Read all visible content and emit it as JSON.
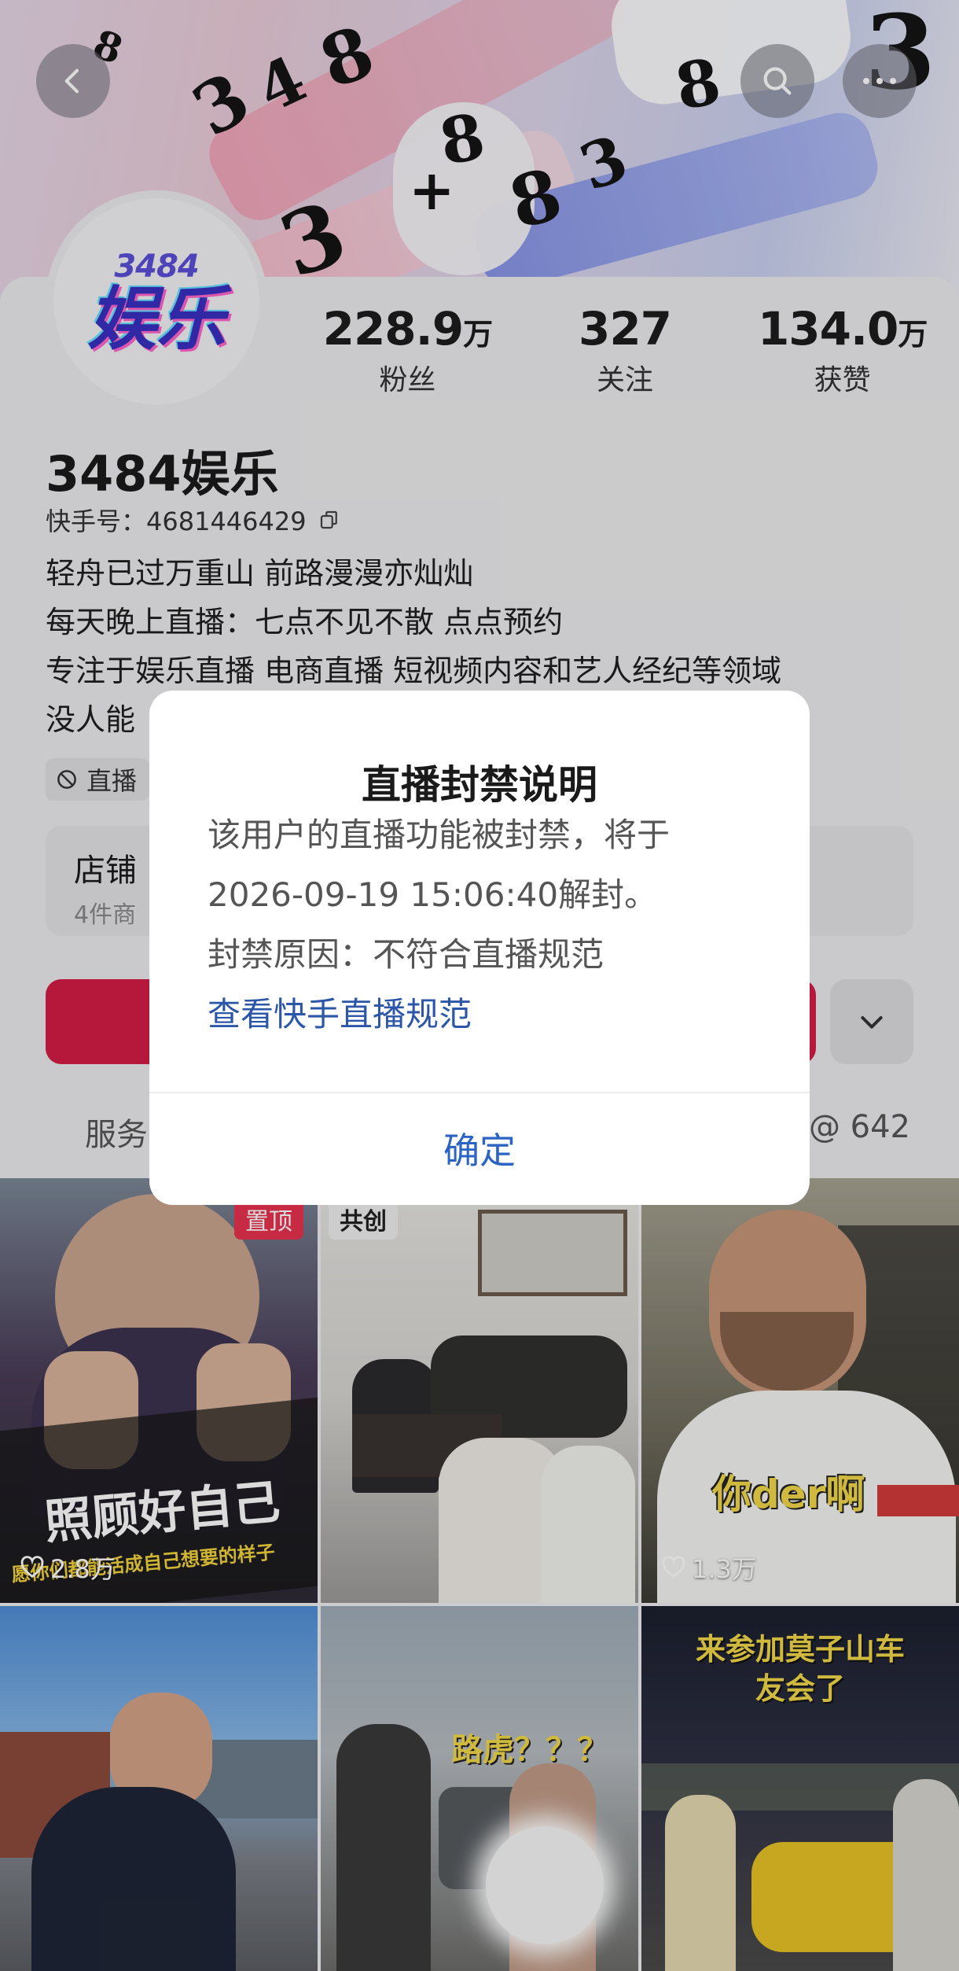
{
  "header": {
    "back_icon": "chevron-left-icon",
    "search_icon": "search-icon",
    "more_icon": "more-dots-icon"
  },
  "profile": {
    "avatar_text_top": "3484",
    "avatar_text_main": "娱乐",
    "name": "3484娱乐",
    "kuaishou_id": "快手号：4681446429",
    "bio": [
      "轻舟已过万重山 前路漫漫亦灿灿",
      "每天晚上直播：七点不见不散 点点预约",
      "专注于娱乐直播 电商直播 短视频内容和艺人经纪等领域",
      "没人能"
    ],
    "tag": "直播",
    "stats": [
      {
        "value": "228.9",
        "unit": "万",
        "label": "粉丝"
      },
      {
        "value": "327",
        "unit": "",
        "label": "关注"
      },
      {
        "value": "134.0",
        "unit": "万",
        "label": "获赞"
      }
    ]
  },
  "shop": {
    "title": "店铺",
    "subtitle": "4件商"
  },
  "tabs": {
    "service": "服务",
    "mentions": "@ 642"
  },
  "videos": [
    {
      "badge": "置顶",
      "caption": "照顾好自己",
      "subcaption": "愿你们都能活成自己想要的样子",
      "likes": "2.8万"
    },
    {
      "badge": "共创",
      "caption": "",
      "likes": ""
    },
    {
      "badge": "",
      "caption": "你der啊",
      "likes": "1.3万"
    },
    {
      "badge": "",
      "caption": "",
      "likes": ""
    },
    {
      "badge": "",
      "caption": "路虎？？？",
      "likes": ""
    },
    {
      "badge": "",
      "caption": "来参加莫子山车友会了",
      "likes": ""
    }
  ],
  "dialog": {
    "title": "直播封禁说明",
    "line1": "该用户的直播功能被封禁，将于",
    "line2": "2026-09-19 15:06:40解封。",
    "line3": "封禁原因：不符合直播规范",
    "link": "查看快手直播规范",
    "confirm": "确定"
  },
  "colors": {
    "accent": "#d31d45",
    "link": "#2c56a8",
    "confirm": "#2c64c4",
    "pin_badge": "#e8324f"
  }
}
